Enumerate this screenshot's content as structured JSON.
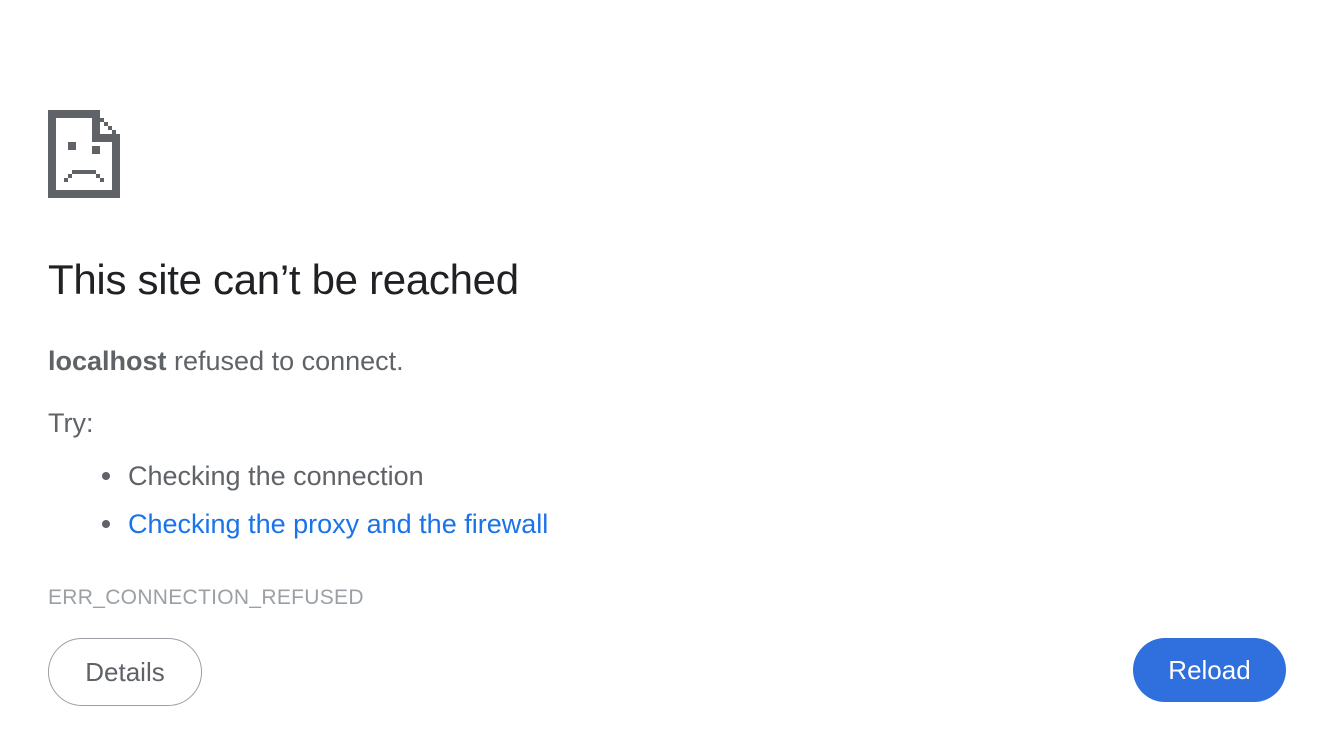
{
  "icon": {
    "name": "sad-page-icon",
    "color": "#5f6368"
  },
  "heading": "This site can’t be reached",
  "message": {
    "host": "localhost",
    "text": " refused to connect."
  },
  "try_label": "Try:",
  "suggestions": [
    {
      "text": "Checking the connection",
      "link": false
    },
    {
      "text": "Checking the proxy and the firewall",
      "link": true
    }
  ],
  "error_code": "ERR_CONNECTION_REFUSED",
  "buttons": {
    "details_label": "Details",
    "reload_label": "Reload"
  },
  "colors": {
    "heading": "#202124",
    "body_text": "#5f6368",
    "link": "#1a73e8",
    "error_code": "#9aa0a6",
    "reload_button": "#2f6fde"
  }
}
